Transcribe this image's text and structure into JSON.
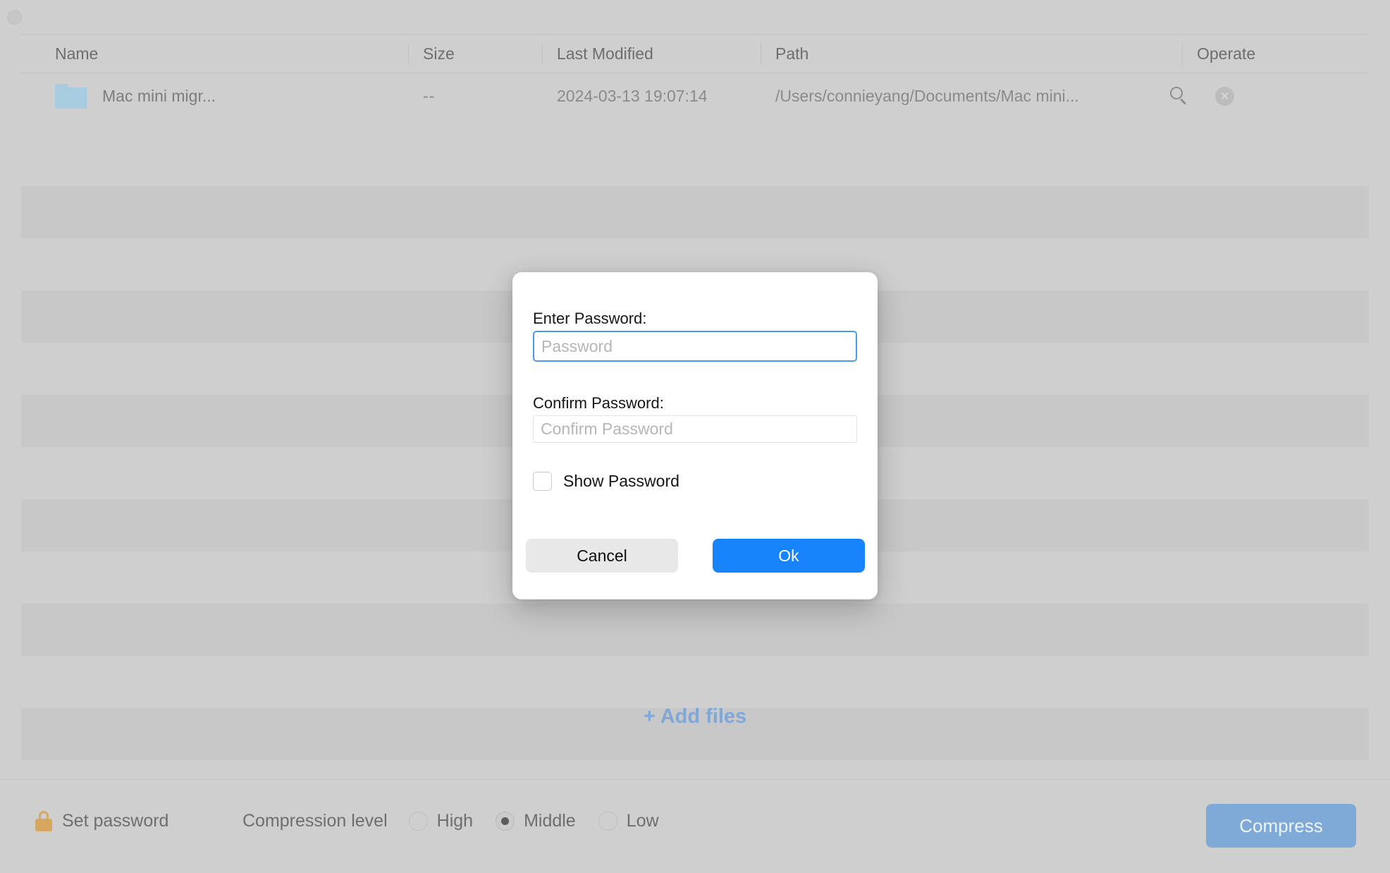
{
  "window": {
    "close_button": "close-window"
  },
  "table": {
    "columns": [
      {
        "key": "name",
        "label": "Name"
      },
      {
        "key": "size",
        "label": "Size"
      },
      {
        "key": "modified",
        "label": "Last Modified"
      },
      {
        "key": "path",
        "label": "Path"
      },
      {
        "key": "operate",
        "label": "Operate"
      }
    ],
    "rows": [
      {
        "icon": "folder-icon",
        "name": "Mac mini migr...",
        "size": "--",
        "modified": "2024-03-13 19:07:14",
        "path": "/Users/connieyang/Documents/Mac mini...",
        "actions": [
          "search-icon",
          "delete-icon"
        ]
      }
    ],
    "empty_row_count": 11
  },
  "add_files": {
    "label": "+ Add files",
    "color": "#7fa8d8"
  },
  "bottom_bar": {
    "set_password": {
      "icon": "lock-icon",
      "label": "Set password",
      "icon_color": "#d6a85f"
    },
    "compression": {
      "label": "Compression level",
      "selected": "Middle",
      "options": [
        {
          "label": "High",
          "selected": false
        },
        {
          "label": "Middle",
          "selected": true
        },
        {
          "label": "Low",
          "selected": false
        }
      ]
    },
    "compress_button": {
      "label": "Compress",
      "color": "#7faad8"
    }
  },
  "modal": {
    "enter_password": {
      "label": "Enter Password:",
      "value": "",
      "placeholder": "Password",
      "focused": true,
      "focus_color": "#4a9bf0"
    },
    "confirm_password": {
      "label": "Confirm Password:",
      "value": "",
      "placeholder": "Confirm Password"
    },
    "show_password": {
      "label": "Show Password",
      "checked": false
    },
    "cancel_button": {
      "label": "Cancel",
      "color": "#e8e8e8"
    },
    "ok_button": {
      "label": "Ok",
      "color": "#1784fc"
    }
  }
}
